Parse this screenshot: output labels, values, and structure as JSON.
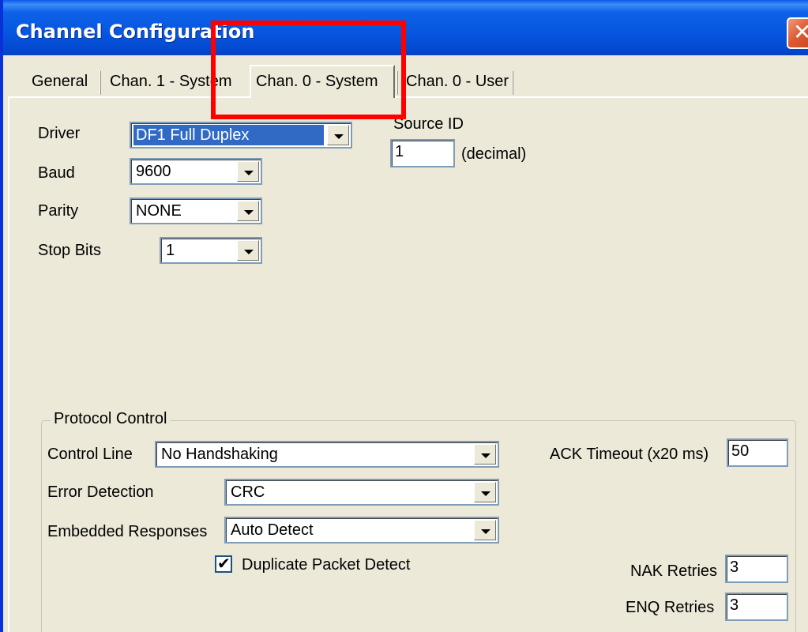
{
  "window": {
    "title": "Channel Configuration"
  },
  "title_bar": {
    "close_glyph": "✕"
  },
  "tabs": [
    {
      "label": "General"
    },
    {
      "label": "Chan. 1 - System"
    },
    {
      "label": "Chan. 0 - System"
    },
    {
      "label": "Chan. 0 - User"
    }
  ],
  "active_tab": "Chan. 0 - System",
  "fields": {
    "driver": {
      "label": "Driver",
      "value": "DF1 Full Duplex"
    },
    "baud": {
      "label": "Baud",
      "value": "9600"
    },
    "parity": {
      "label": "Parity",
      "value": "NONE"
    },
    "stop_bits": {
      "label": "Stop Bits",
      "value": "1"
    },
    "source_id": {
      "label": "Source ID",
      "value": "1",
      "unit": "(decimal)"
    }
  },
  "protocol_control": {
    "title": "Protocol Control",
    "control_line": {
      "label": "Control Line",
      "value": "No Handshaking"
    },
    "error_detection": {
      "label": "Error Detection",
      "value": "CRC"
    },
    "embedded_responses": {
      "label": "Embedded Responses",
      "value": "Auto Detect"
    },
    "duplicate_packet_detect": {
      "label": "Duplicate Packet Detect",
      "checked": true,
      "check_glyph": "✔"
    },
    "ack_timeout": {
      "label": "ACK Timeout (x20 ms)",
      "value": "50"
    },
    "nak_retries": {
      "label": "NAK Retries",
      "value": "3"
    },
    "enq_retries": {
      "label": "ENQ Retries",
      "value": "3"
    }
  },
  "colors": {
    "title_bar": "#0656df",
    "dialog_bg": "#ece9d8",
    "selection": "#316ac5",
    "annotation": "#ff0000"
  }
}
